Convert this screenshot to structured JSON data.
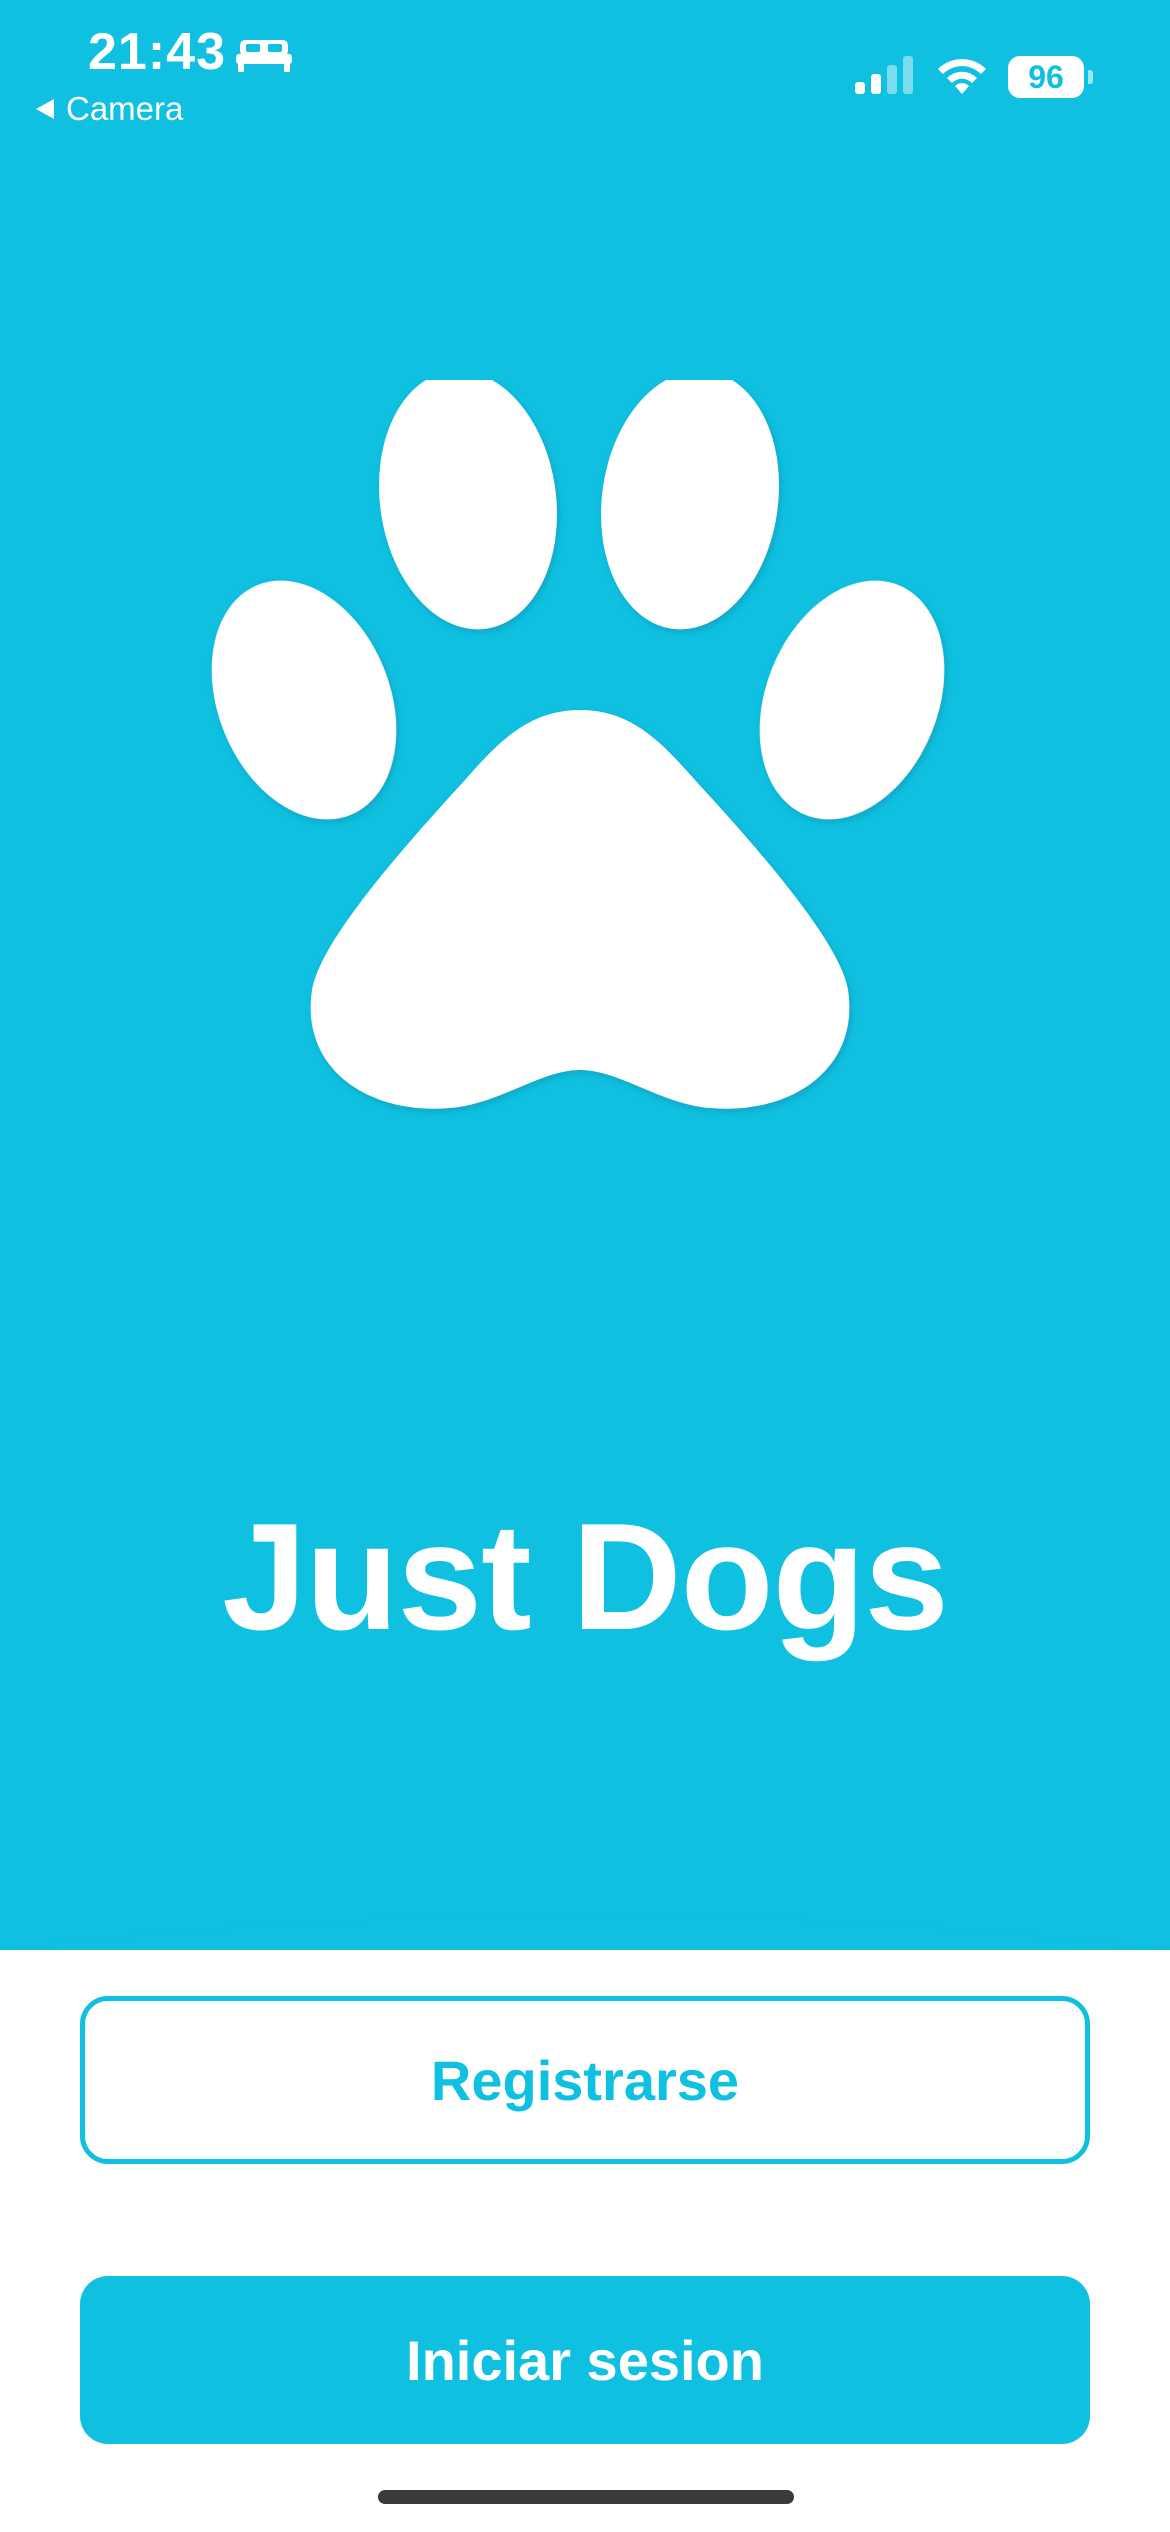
{
  "status_bar": {
    "time": "21:43",
    "back_label": "Camera",
    "battery": "96"
  },
  "app": {
    "title": "Just Dogs"
  },
  "actions": {
    "register_label": "Registrarse",
    "login_label": "Iniciar sesion"
  },
  "colors": {
    "brand": "#0fc0e0",
    "background": "#ffffff"
  },
  "icons": {
    "logo": "paw-icon",
    "status": [
      "bed-icon",
      "signal-icon",
      "wifi-icon",
      "battery-icon"
    ]
  }
}
